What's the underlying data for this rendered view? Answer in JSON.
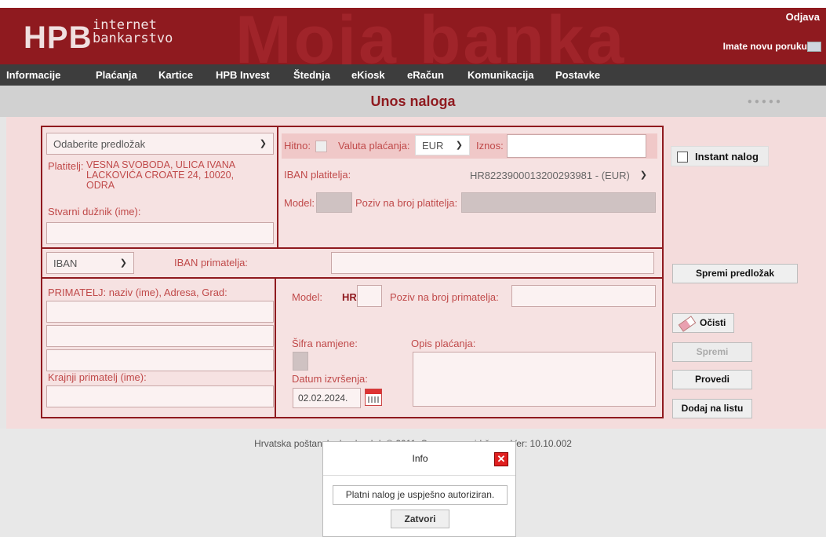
{
  "header": {
    "logo": "HPB",
    "logo_line1": "internet",
    "logo_line2": "bankarstvo",
    "watermark": "Moja banka",
    "logout": "Odjava",
    "new_message": "Imate novu poruku"
  },
  "menu": [
    "Informacije",
    "Plaćanja",
    "Kartice",
    "HPB Invest",
    "Štednja",
    "eKiosk",
    "eRačun",
    "Komunikacija",
    "Postavke"
  ],
  "page": {
    "title": "Unos naloga",
    "progress_dots": "●●●●●"
  },
  "form": {
    "template_select": "Odaberite predložak",
    "payer_label": "Platitelj:",
    "payer_value": "VESNA SVOBODA, ULICA IVANA LACKOVIĆA CROATE 24, 10020, ODRA",
    "actual_debtor_label": "Stvarni dužnik (ime):",
    "urgent_label": "Hitno:",
    "currency_label": "Valuta plaćanja:",
    "currency_value": "EUR",
    "amount_label": "Iznos:",
    "payer_iban_label": "IBAN platitelja:",
    "payer_iban_value": "HR8223900013200293981 - (EUR)",
    "model_label": "Model:",
    "payer_ref_label": "Poziv na broj platitelja:",
    "account_type": "IBAN",
    "recipient_iban_label": "IBAN primatelja:",
    "recipient_label": "PRIMATELJ: naziv (ime), Adresa, Grad:",
    "final_recipient_label": "Krajnji primatelj (ime):",
    "recipient_model_label": "Model:",
    "recipient_model_prefix": "HR",
    "recipient_ref_label": "Poziv na broj primatelja:",
    "purpose_code_label": "Šifra namjene:",
    "description_label": "Opis plaćanja:",
    "execution_date_label": "Datum izvršenja:",
    "execution_date_value": "02.02.2024."
  },
  "side": {
    "instant_label": "Instant nalog",
    "save_template": "Spremi predložak",
    "clear": "Očisti",
    "save": "Spremi",
    "execute": "Provedi",
    "add_to_list": "Dodaj na listu"
  },
  "footer": {
    "text": "Hrvatska poštanska banka d.d. © 2011. Sva prava pridržana. Ver: 10.10.002"
  },
  "dialog": {
    "title": "Info",
    "message": "Platni nalog je uspješno autoriziran.",
    "close_button": "Zatvori"
  }
}
